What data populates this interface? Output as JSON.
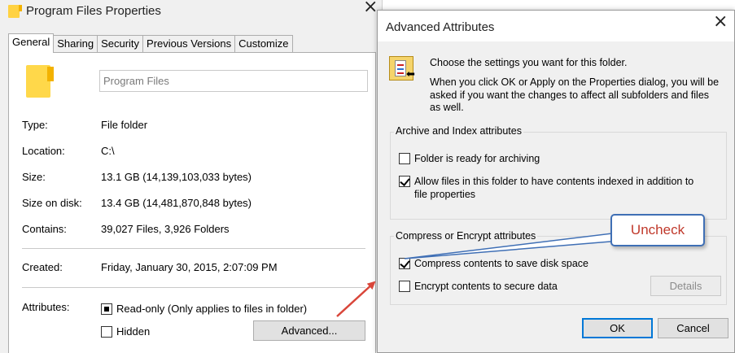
{
  "properties": {
    "title": "Program Files Properties",
    "tabs": [
      {
        "label": "General",
        "active": true
      },
      {
        "label": "Sharing"
      },
      {
        "label": "Security"
      },
      {
        "label": "Previous Versions"
      },
      {
        "label": "Customize"
      }
    ],
    "name_value": "Program Files",
    "rows": [
      {
        "label": "Type:",
        "value": "File folder"
      },
      {
        "label": "Location:",
        "value": "C:\\"
      },
      {
        "label": "Size:",
        "value": "13.1 GB (14,139,103,033 bytes)"
      },
      {
        "label": "Size on disk:",
        "value": "13.4 GB (14,481,870,848 bytes)"
      },
      {
        "label": "Contains:",
        "value": "39,027 Files, 3,926 Folders"
      },
      {
        "label": "Created:",
        "value": "Friday, January 30, 2015, 2:07:09 PM"
      },
      {
        "label": "Attributes:",
        "value": ""
      }
    ],
    "readonly_label": "Read-only (Only applies to files in folder)",
    "hidden_label": "Hidden",
    "advanced_button": "Advanced..."
  },
  "advanced": {
    "title": "Advanced Attributes",
    "intro": "Choose the settings you want for this folder.",
    "detail_lines": [
      "When you click OK or Apply on the Properties dialog, you will be",
      "asked if you want the changes to affect all subfolders and files",
      "as well."
    ],
    "archive_group": "Archive and Index attributes",
    "archive_option": "Folder is ready for archiving",
    "index_option_lines": [
      "Allow files in this folder to have contents indexed in addition to",
      "file properties"
    ],
    "compress_group": "Compress or Encrypt attributes",
    "compress_option": "Compress contents to save disk space",
    "encrypt_option": "Encrypt contents to secure data",
    "details_button": "Details",
    "ok_button": "OK",
    "cancel_button": "Cancel"
  },
  "callout": {
    "text": "Uncheck"
  },
  "colors": {
    "arrow": "#d9463a",
    "callout_border": "#3f6fb5",
    "callout_text": "#c0392b",
    "dialog_bg": "#f0f0f0",
    "focus_blue": "#0078d7"
  }
}
